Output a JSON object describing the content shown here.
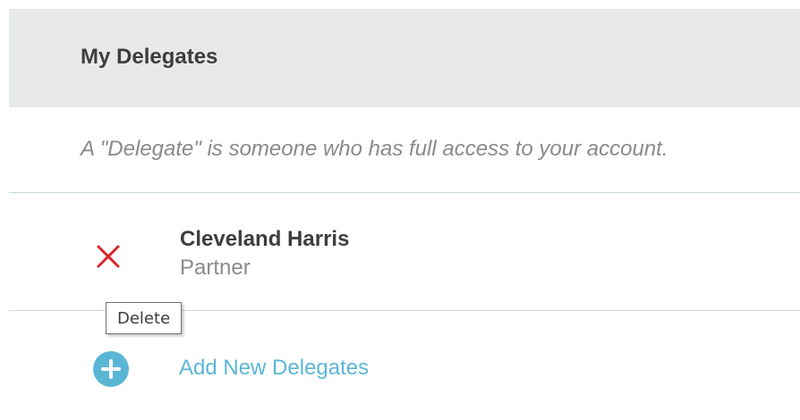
{
  "header": {
    "title": "My Delegates"
  },
  "description": "A \"Delegate\" is someone who has full access to your account.",
  "delegates": [
    {
      "name": "Cleveland Harris",
      "role": "Partner",
      "delete_icon": "close-icon"
    }
  ],
  "tooltip": {
    "text": "Delete"
  },
  "add": {
    "label": "Add New Delegates",
    "icon": "plus-circle-icon"
  },
  "colors": {
    "header_bg": "#e8e9eb",
    "delete": "#d9262b",
    "accent": "#5bb6d6",
    "divider": "#c9d6df",
    "muted_text": "#8a8a8a",
    "primary_text": "#3d3d3d"
  }
}
